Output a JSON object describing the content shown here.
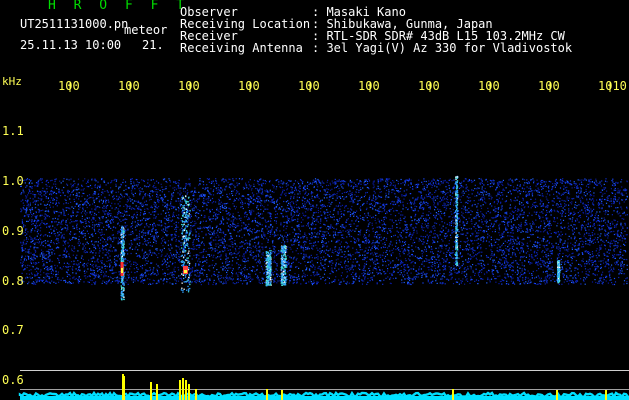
{
  "title": "H R O F F T",
  "file_name": "UT2511131000.pn",
  "meteor_label": "meteor",
  "datetime": "25.11.13 10:00",
  "count": "21.",
  "info": [
    {
      "label": "Observer",
      "value": ": Masaki Kano"
    },
    {
      "label": "Receiving Location",
      "value": ": Shibukawa, Gunma, Japan"
    },
    {
      "label": "Receiver",
      "value": ": RTL-SDR SDR# 43dB L15 103.2MHz CW"
    },
    {
      "label": "Receiving Antenna",
      "value": ": 3el Yagi(V) Az 330 for Vladivostok"
    }
  ],
  "y_unit": "kHz",
  "x_ticks": [
    "100",
    "100",
    "100",
    "100",
    "100",
    "100",
    "100",
    "100",
    "100",
    "1010"
  ],
  "y_ticks": [
    "1.1",
    "1.0",
    "0.9",
    "0.8",
    "0.7",
    "0.6"
  ],
  "colors": {
    "background": "#000000",
    "title": "#00dd00",
    "ticks": "#ffff55",
    "noise": "#1020c0",
    "baseline": "#00e0ff",
    "spike": "#ffff00"
  }
}
